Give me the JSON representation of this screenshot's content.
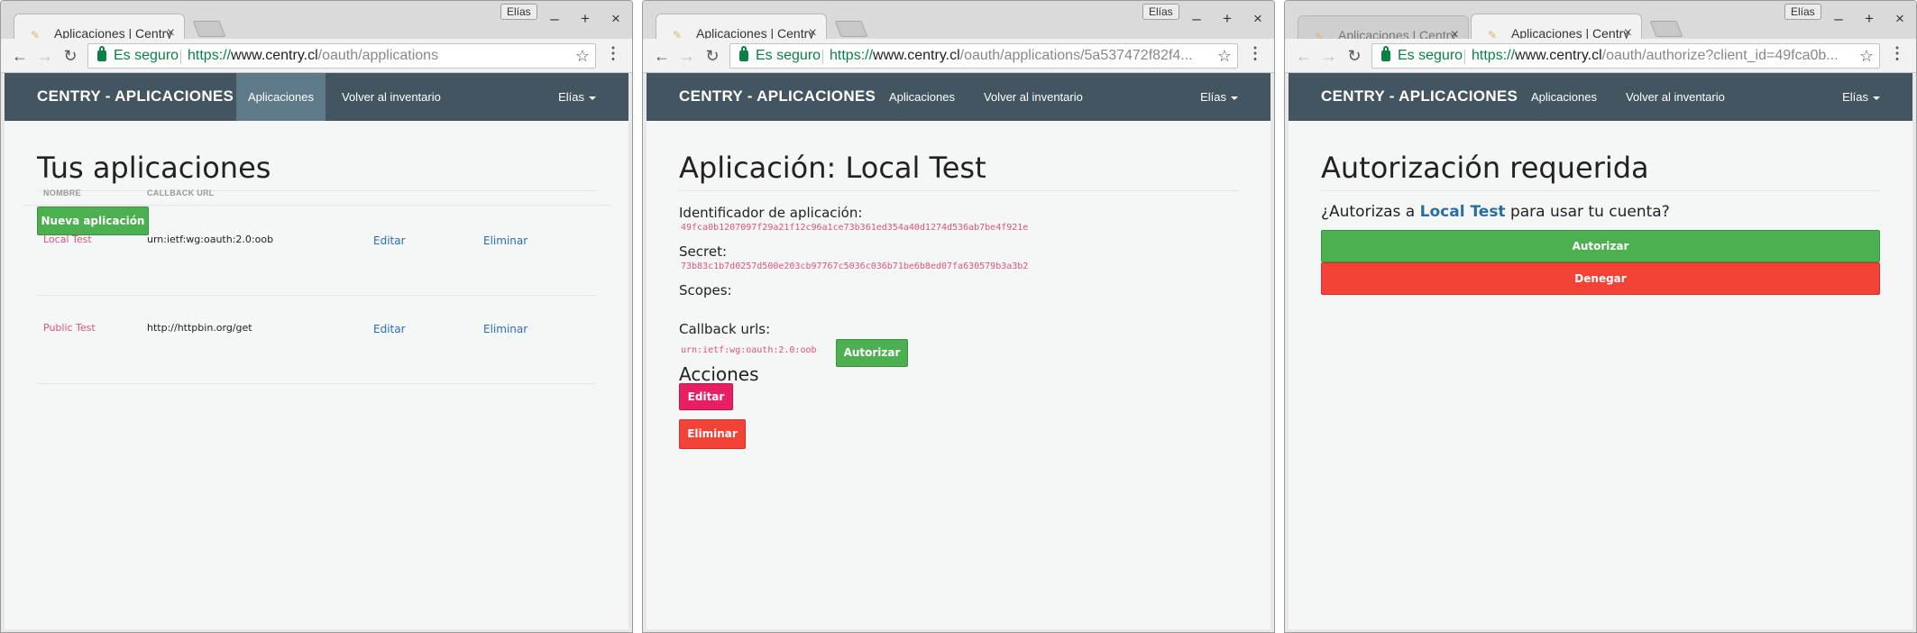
{
  "windows": [
    {
      "tabs": [
        {
          "title": "Aplicaciones | Centry"
        }
      ],
      "user_badge": "Elías",
      "address": {
        "secure_label": "Es seguro",
        "scheme": "https://",
        "host": "www.centry.cl",
        "path": "/oauth/applications"
      },
      "navbar": {
        "brand": "CENTRY - APLICACIONES",
        "links": [
          "Aplicaciones",
          "Volver al inventario"
        ],
        "user": "Elías"
      },
      "heading": "Tus aplicaciones",
      "new_app_button": "Nueva aplicación",
      "table": {
        "headers": [
          "NOMBRE",
          "CALLBACK URL"
        ],
        "rows": [
          {
            "name": "Local Test",
            "callback": "urn:ietf:wg:oauth:2.0:oob",
            "edit": "Editar",
            "delete": "Eliminar"
          },
          {
            "name": "Public Test",
            "callback": "http://httpbin.org/get",
            "edit": "Editar",
            "delete": "Eliminar"
          }
        ]
      }
    },
    {
      "tabs": [
        {
          "title": "Aplicaciones | Centry"
        }
      ],
      "user_badge": "Elías",
      "address": {
        "secure_label": "Es seguro",
        "scheme": "https://",
        "host": "www.centry.cl",
        "path": "/oauth/applications/5a537472f82f4..."
      },
      "navbar": {
        "brand": "CENTRY - APLICACIONES",
        "links": [
          "Aplicaciones",
          "Volver al inventario"
        ],
        "user": "Elías"
      },
      "heading": "Aplicación: Local Test",
      "uid_label": "Identificador de aplicación:",
      "uid": "49fca0b1207097f29a21f12c96a1ce73b361ed354a40d1274d536ab7be4f921e",
      "secret_label": "Secret:",
      "secret": "73b83c1b7d0257d500e203cb97767c5036c036b71be6b8ed07fa630579b3a3b2",
      "scopes_label": "Scopes:",
      "callback_label": "Callback urls:",
      "callback": "urn:ietf:wg:oauth:2.0:oob",
      "authorize_button": "Autorizar",
      "actions_heading": "Acciones",
      "edit_button": "Editar",
      "delete_button": "Eliminar"
    },
    {
      "tabs": [
        {
          "title": "Aplicaciones | Centry"
        },
        {
          "title": "Aplicaciones | Centry"
        }
      ],
      "user_badge": "Elías",
      "address": {
        "secure_label": "Es seguro",
        "scheme": "https://",
        "host": "www.centry.cl",
        "path": "/oauth/authorize?client_id=49fca0b..."
      },
      "navbar": {
        "brand": "CENTRY - APLICACIONES",
        "links": [
          "Aplicaciones",
          "Volver al inventario"
        ],
        "user": "Elías"
      },
      "heading": "Autorización requerida",
      "question_pre": "¿Autorizas a ",
      "question_app": "Local Test",
      "question_post": " para usar tu cuenta?",
      "authorize_button": "Autorizar",
      "deny_button": "Denegar"
    }
  ],
  "colors": {
    "navbar": "#435560",
    "active_nav": "#5e7a88",
    "green": "#4caf50",
    "pink": "#e91e63",
    "red": "#f44336",
    "link": "#2a6ebb",
    "secure": "#0b8043"
  }
}
